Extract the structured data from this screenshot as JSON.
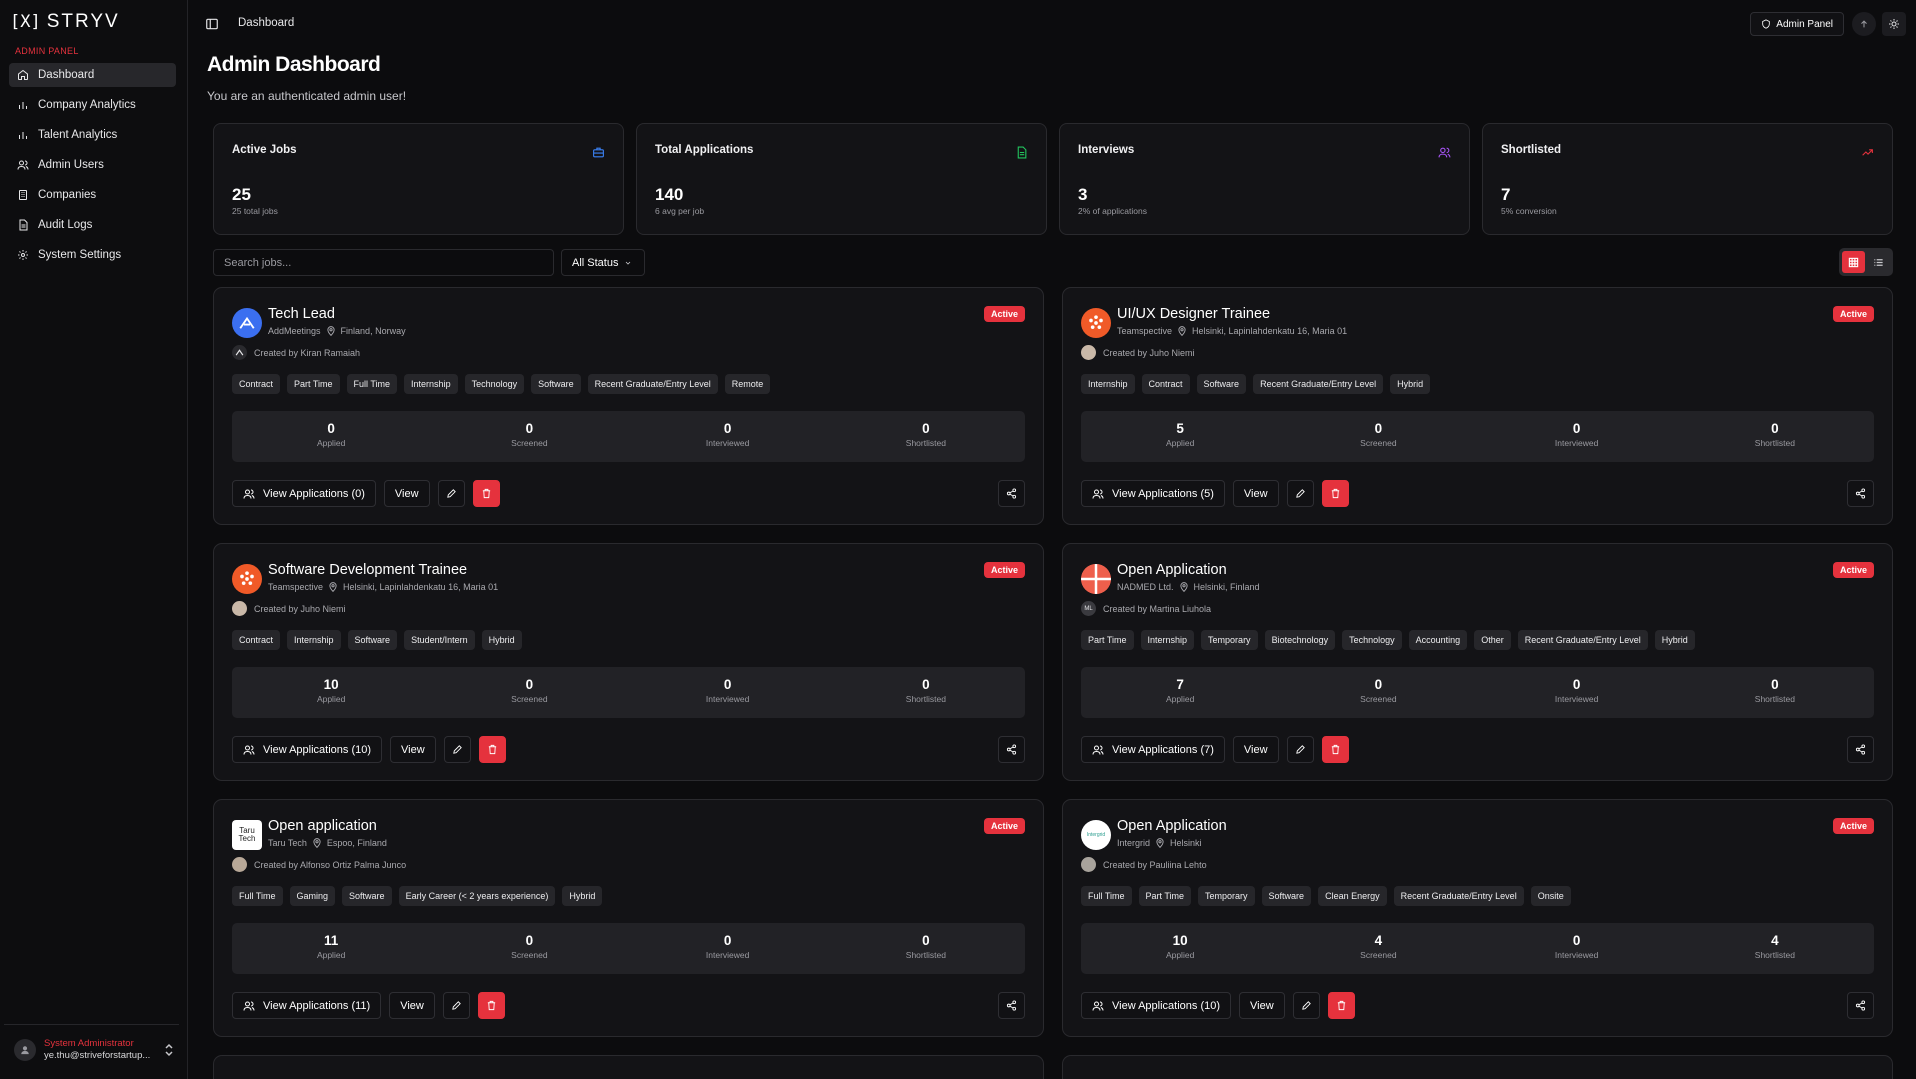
{
  "brand": {
    "logo_mark": "[X]",
    "logo_text": "STRYV"
  },
  "sidebar": {
    "section_label": "ADMIN PANEL",
    "items": [
      {
        "label": "Dashboard",
        "icon": "home-icon",
        "active": true
      },
      {
        "label": "Company Analytics",
        "icon": "bar-chart-icon"
      },
      {
        "label": "Talent Analytics",
        "icon": "bar-chart-icon"
      },
      {
        "label": "Admin Users",
        "icon": "users-icon"
      },
      {
        "label": "Companies",
        "icon": "building-icon"
      },
      {
        "label": "Audit Logs",
        "icon": "file-icon"
      },
      {
        "label": "System Settings",
        "icon": "gear-icon"
      }
    ],
    "user": {
      "role": "System Administrator",
      "email": "ye.thu@striveforstartup..."
    }
  },
  "topbar": {
    "breadcrumb": "Dashboard",
    "admin_panel_label": "Admin Panel"
  },
  "header": {
    "title": "Admin Dashboard",
    "subtitle": "You are an authenticated admin user!"
  },
  "stats": [
    {
      "title": "Active Jobs",
      "value": "25",
      "note": "25 total jobs",
      "icon": "briefcase-icon",
      "color": "#3b82f6"
    },
    {
      "title": "Total Applications",
      "value": "140",
      "note": "6 avg per job",
      "icon": "document-icon",
      "color": "#22c55e"
    },
    {
      "title": "Interviews",
      "value": "3",
      "note": "2% of applications",
      "icon": "users-icon",
      "color": "#a855f7"
    },
    {
      "title": "Shortlisted",
      "value": "7",
      "note": "5% conversion",
      "icon": "trending-up-icon",
      "color": "#e5323d"
    }
  ],
  "filters": {
    "search_placeholder": "Search jobs...",
    "status_value": "All Status"
  },
  "metric_labels": {
    "applied": "Applied",
    "screened": "Screened",
    "interviewed": "Interviewed",
    "shortlisted": "Shortlisted"
  },
  "buttons": {
    "view": "View"
  },
  "jobs": [
    {
      "title": "Tech Lead",
      "company": "AddMeetings",
      "location": "Finland, Norway",
      "created_by": "Created by Kiran Ramaiah",
      "status": "Active",
      "tags": [
        "Contract",
        "Part Time",
        "Full Time",
        "Internship",
        "Technology",
        "Software",
        "Recent Graduate/Entry Level",
        "Remote"
      ],
      "applied": "0",
      "screened": "0",
      "interviewed": "0",
      "shortlisted": "0",
      "view_apps": "View Applications (0)",
      "logo": "addmeetings-logo"
    },
    {
      "title": "UI/UX Designer Trainee",
      "company": "Teamspective",
      "location": "Helsinki, Lapinlahdenkatu 16, Maria 01",
      "created_by": "Created by Juho Niemi",
      "status": "Active",
      "tags": [
        "Internship",
        "Contract",
        "Software",
        "Recent Graduate/Entry Level",
        "Hybrid"
      ],
      "applied": "5",
      "screened": "0",
      "interviewed": "0",
      "shortlisted": "0",
      "view_apps": "View Applications (5)",
      "logo": "teamspective-logo"
    },
    {
      "title": "Software Development Trainee",
      "company": "Teamspective",
      "location": "Helsinki, Lapinlahdenkatu 16, Maria 01",
      "created_by": "Created by Juho Niemi",
      "status": "Active",
      "tags": [
        "Contract",
        "Internship",
        "Software",
        "Student/Intern",
        "Hybrid"
      ],
      "applied": "10",
      "screened": "0",
      "interviewed": "0",
      "shortlisted": "0",
      "view_apps": "View Applications (10)",
      "logo": "teamspective-logo"
    },
    {
      "title": "Open Application",
      "company": "NADMED Ltd.",
      "location": "Helsinki, Finland",
      "created_by": "Created by Martina Liuhola",
      "status": "Active",
      "avatar_initials": "ML",
      "tags": [
        "Part Time",
        "Internship",
        "Temporary",
        "Biotechnology",
        "Technology",
        "Accounting",
        "Other",
        "Recent Graduate/Entry Level",
        "Hybrid"
      ],
      "applied": "7",
      "screened": "0",
      "interviewed": "0",
      "shortlisted": "0",
      "view_apps": "View Applications (7)",
      "logo": "nadmed-logo"
    },
    {
      "title": "Open application",
      "company": "Taru Tech",
      "location": "Espoo, Finland",
      "created_by": "Created by Alfonso Ortiz Palma Junco",
      "status": "Active",
      "logo_text": "Taru Tech",
      "tags": [
        "Full Time",
        "Gaming",
        "Software",
        "Early Career (< 2 years experience)",
        "Hybrid"
      ],
      "applied": "11",
      "screened": "0",
      "interviewed": "0",
      "shortlisted": "0",
      "view_apps": "View Applications (11)",
      "logo": "tarutech-logo"
    },
    {
      "title": "Open Application",
      "company": "Intergrid",
      "location": "Helsinki",
      "created_by": "Created by Pauliina Lehto",
      "status": "Active",
      "logo_text": "Intergrid",
      "tags": [
        "Full Time",
        "Part Time",
        "Temporary",
        "Software",
        "Clean Energy",
        "Recent Graduate/Entry Level",
        "Onsite"
      ],
      "applied": "10",
      "screened": "4",
      "interviewed": "0",
      "shortlisted": "4",
      "view_apps": "View Applications (10)",
      "logo": "intergrid-logo"
    }
  ]
}
